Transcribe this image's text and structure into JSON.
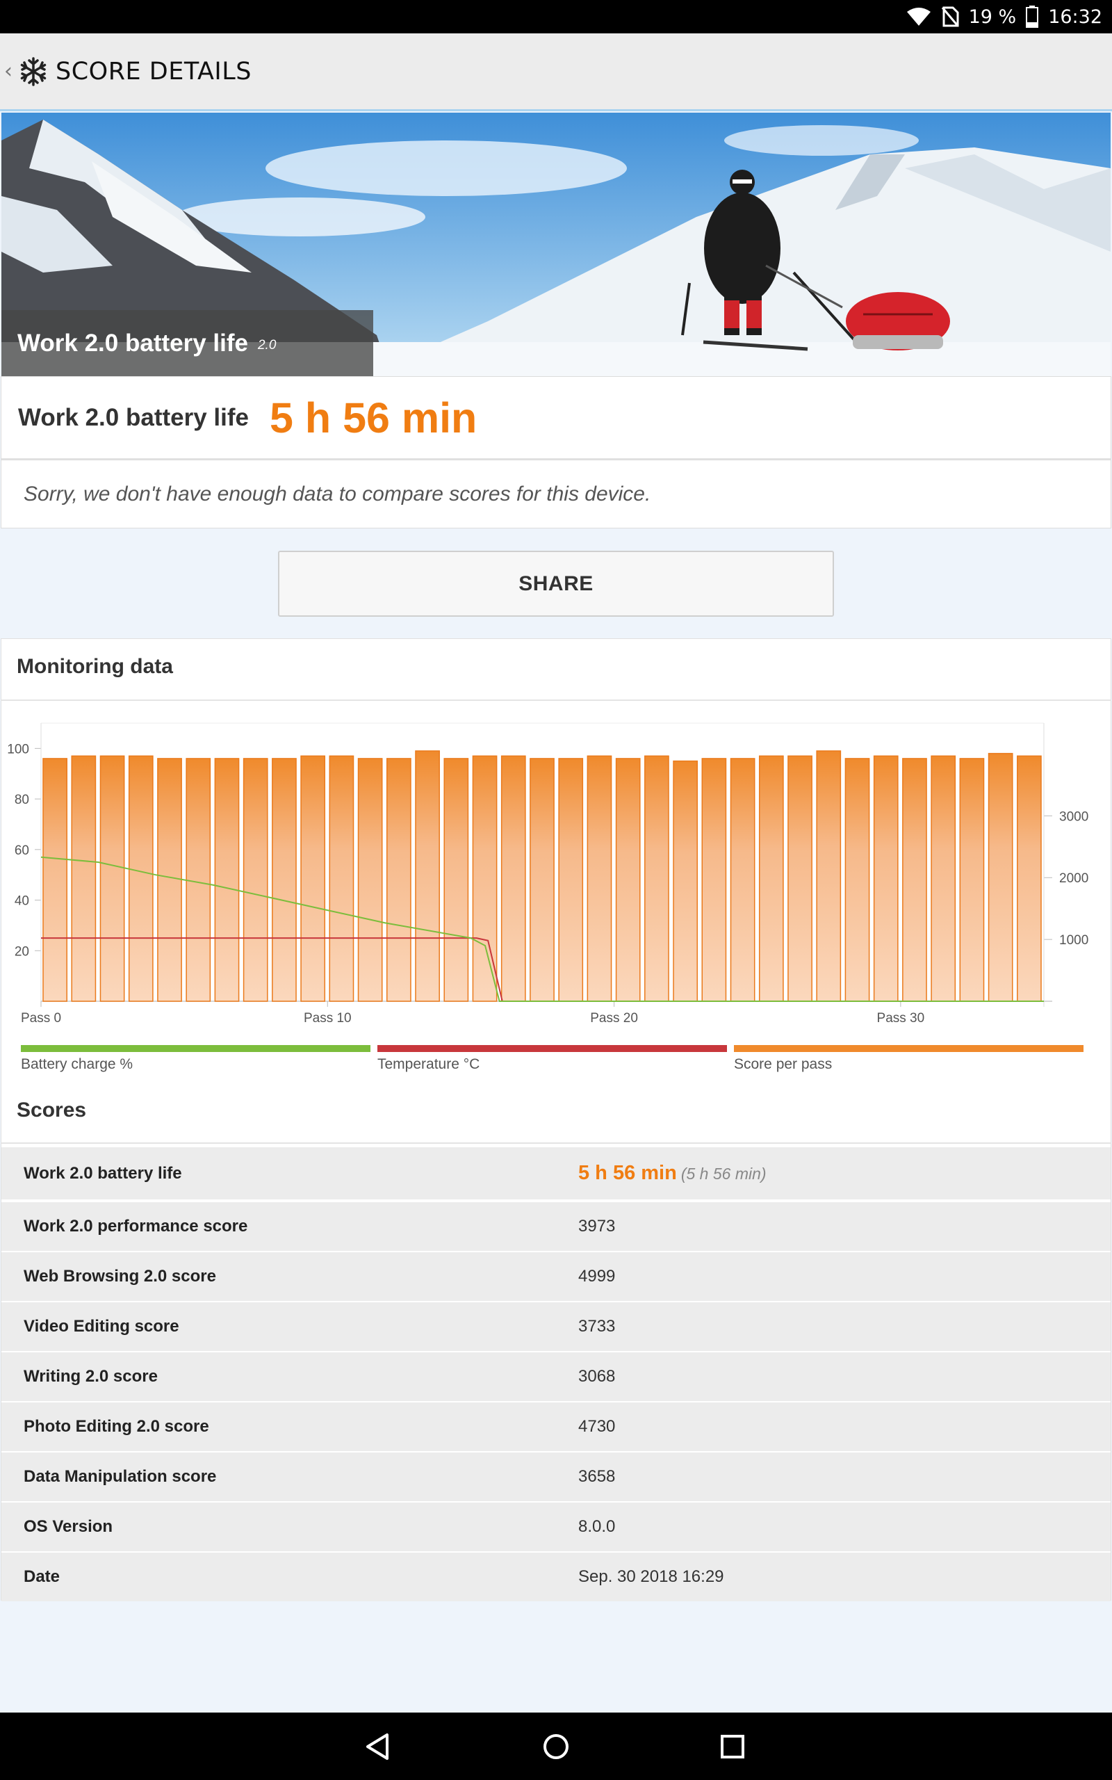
{
  "status_bar": {
    "battery": "19 %",
    "time": "16:32"
  },
  "app_bar": {
    "back": "‹",
    "title": "SCORE DETAILS"
  },
  "hero": {
    "title": "Work 2.0 battery life",
    "version": "2.0"
  },
  "result": {
    "label": "Work 2.0 battery life",
    "value": "5 h 56 min"
  },
  "notice": "Sorry, we don't have enough data to compare scores for this device.",
  "share_label": "SHARE",
  "monitoring": {
    "title": "Monitoring data",
    "legend": [
      {
        "label": "Battery charge %",
        "color": "#7cbd3c"
      },
      {
        "label": "Temperature °C",
        "color": "#c8373c"
      },
      {
        "label": "Score per pass",
        "color": "#f08a2c"
      }
    ]
  },
  "chart_data": {
    "type": "bar",
    "x_tick_labels": [
      "Pass 0",
      "Pass 10",
      "Pass 20",
      "Pass 30"
    ],
    "y_left_ticks": [
      20,
      40,
      60,
      80,
      100
    ],
    "y_left_range": [
      0,
      110
    ],
    "y_right_ticks": [
      1000,
      2000,
      3000
    ],
    "y_right_range": [
      0,
      4500
    ],
    "series": [
      {
        "name": "Score per pass",
        "axis": "left",
        "color": "#f08a2c",
        "values": [
          96,
          97,
          97,
          97,
          96,
          96,
          96,
          96,
          96,
          97,
          97,
          96,
          96,
          99,
          96,
          97,
          97,
          96,
          96,
          97,
          96,
          97,
          95,
          96,
          96,
          97,
          97,
          99,
          96,
          97,
          96,
          97,
          96,
          98,
          97
        ]
      },
      {
        "name": "Battery charge %",
        "axis": "left",
        "color": "#7cbd3c",
        "x": [
          0,
          2,
          4,
          6,
          8,
          10,
          12,
          14,
          15,
          15.5,
          16,
          35
        ],
        "values": [
          57,
          55,
          50,
          46,
          41,
          36,
          31,
          27,
          25,
          22,
          0,
          0
        ]
      },
      {
        "name": "Temperature °C",
        "axis": "left",
        "color": "#c8373c",
        "x": [
          0,
          15.2,
          15.6,
          16.1,
          35
        ],
        "values": [
          25,
          25,
          24,
          0,
          0
        ]
      }
    ]
  },
  "scores": {
    "title": "Scores",
    "rows": [
      {
        "label": "Work 2.0 battery life",
        "value": "5 h 56 min",
        "sub": "(5 h 56 min)"
      },
      {
        "label": "Work 2.0 performance score",
        "value": "3973"
      },
      {
        "label": "Web Browsing 2.0 score",
        "value": "4999"
      },
      {
        "label": "Video Editing score",
        "value": "3733"
      },
      {
        "label": "Writing 2.0 score",
        "value": "3068"
      },
      {
        "label": "Photo Editing 2.0 score",
        "value": "4730"
      },
      {
        "label": "Data Manipulation score",
        "value": "3658"
      },
      {
        "label": "OS Version",
        "value": "8.0.0"
      },
      {
        "label": "Date",
        "value": "Sep. 30 2018 16:29"
      }
    ]
  }
}
